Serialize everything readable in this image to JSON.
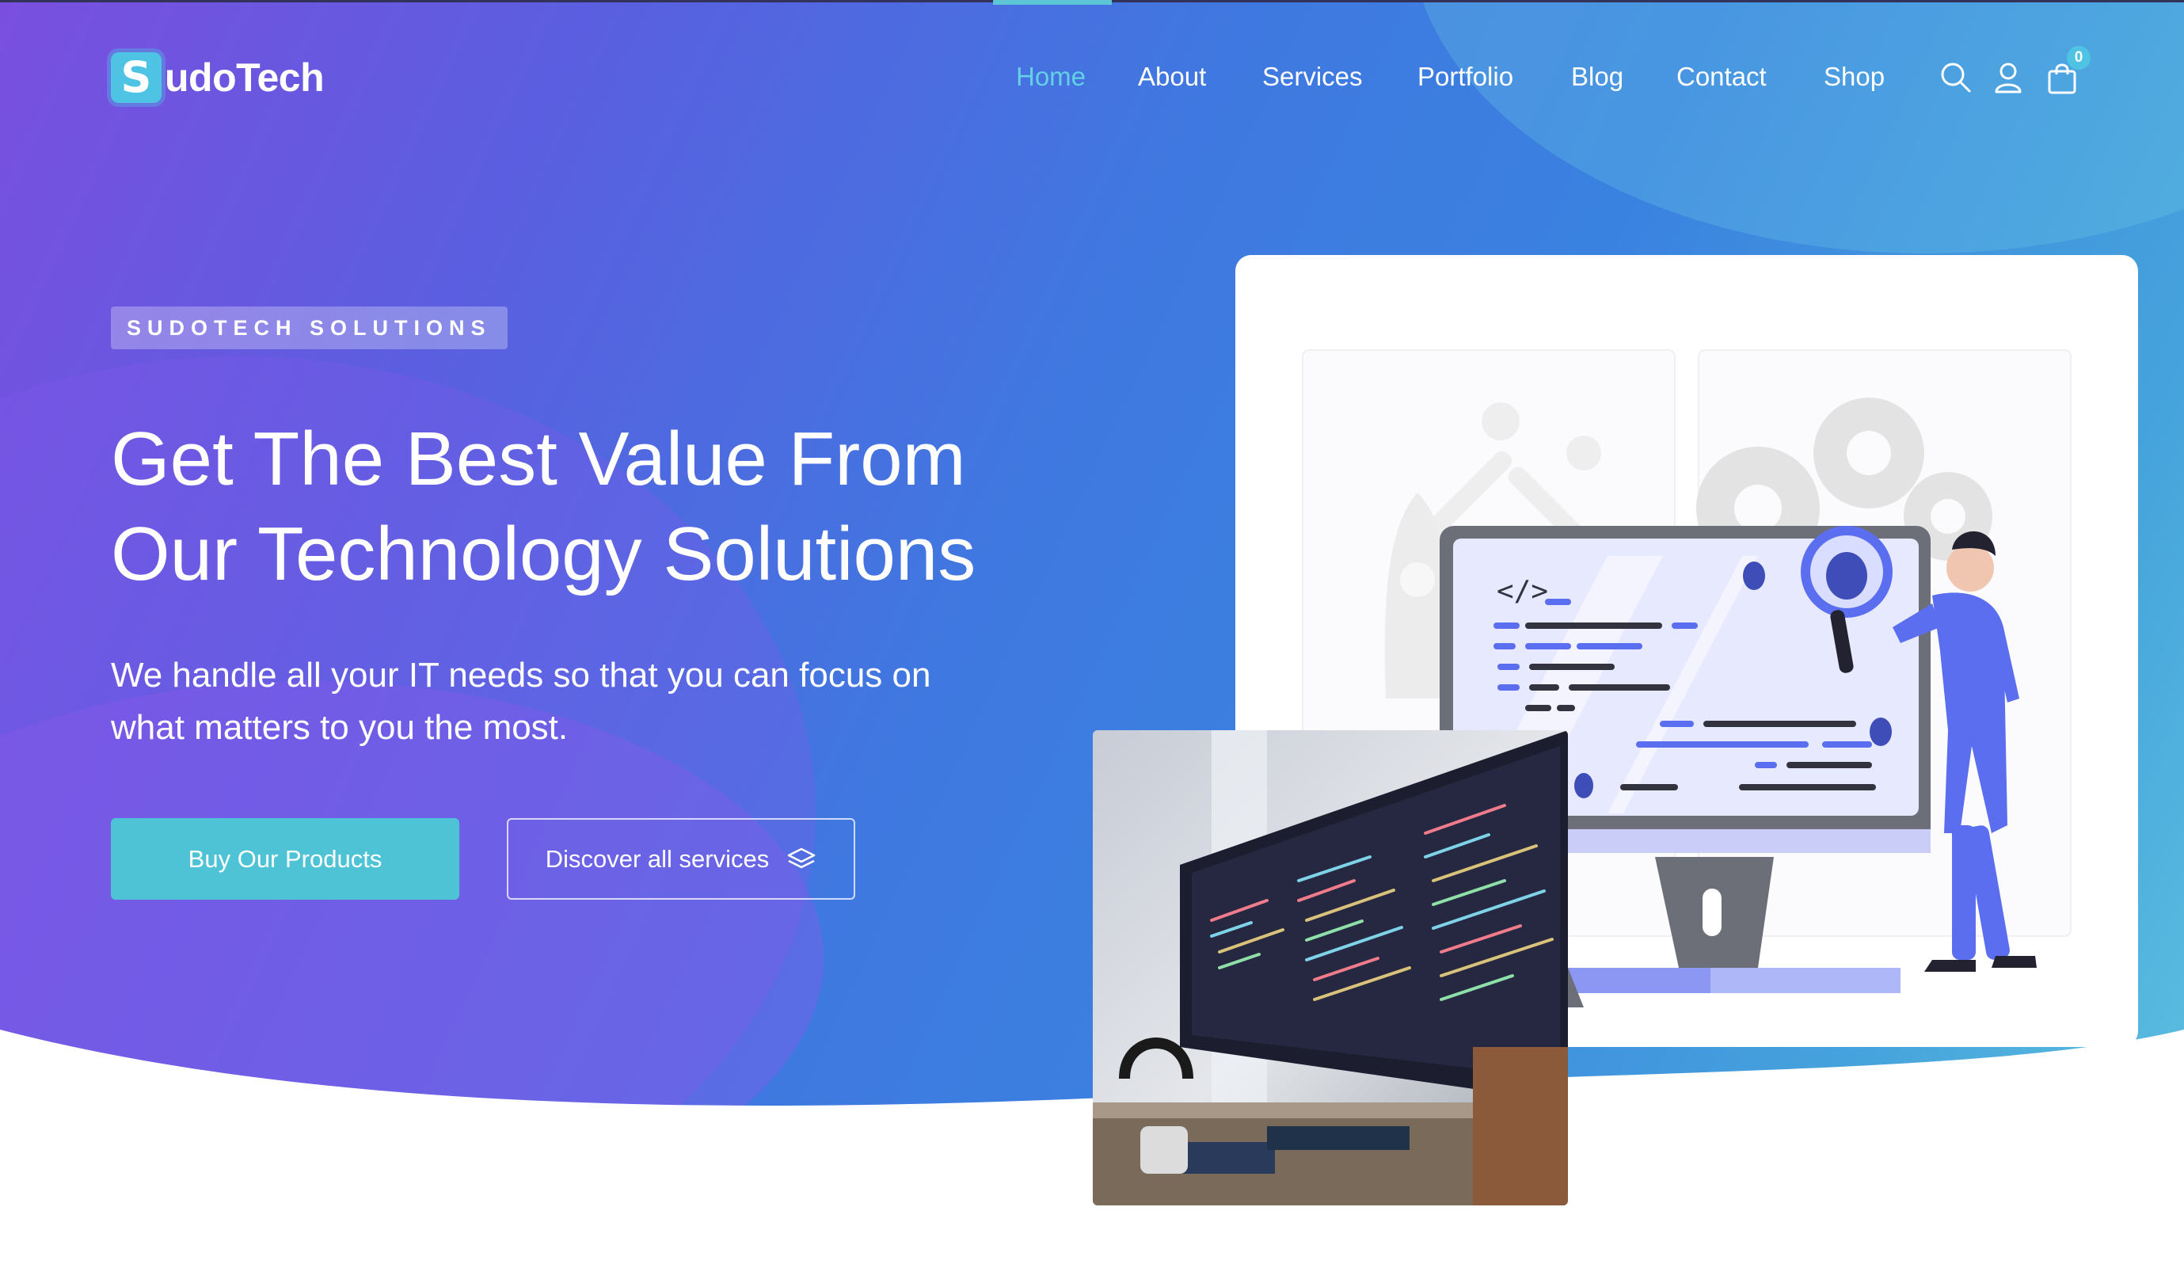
{
  "brand": {
    "name_letter": "S",
    "name_rest": "udoTech"
  },
  "nav": {
    "items": [
      {
        "label": "Home",
        "active": true
      },
      {
        "label": "About",
        "active": false
      },
      {
        "label": "Services",
        "active": false
      },
      {
        "label": "Portfolio",
        "active": false
      },
      {
        "label": "Blog",
        "active": false
      },
      {
        "label": "Contact",
        "active": false
      },
      {
        "label": "Shop",
        "active": false
      }
    ],
    "icons": [
      "search-icon",
      "user-icon",
      "shopping-bag-icon"
    ],
    "cart_count": "0"
  },
  "hero": {
    "tag": "SUDOTECH SOLUTIONS",
    "headline_line1": "Get The Best Value From",
    "headline_line2": "Our Technology Solutions",
    "subtext_line1": "We handle all your IT needs so that you can focus on",
    "subtext_line2": "what matters to you the most.",
    "primary_button": "Buy Our Products",
    "secondary_button": "Discover all services"
  },
  "illustration": {
    "code_tag": "</>"
  },
  "colors": {
    "accent": "#4fc3d6",
    "active_nav": "#63d0e6",
    "gradient_start": "#7a4fe0",
    "gradient_end": "#5fc3e0",
    "illustration_blue": "#5b6ef0"
  }
}
